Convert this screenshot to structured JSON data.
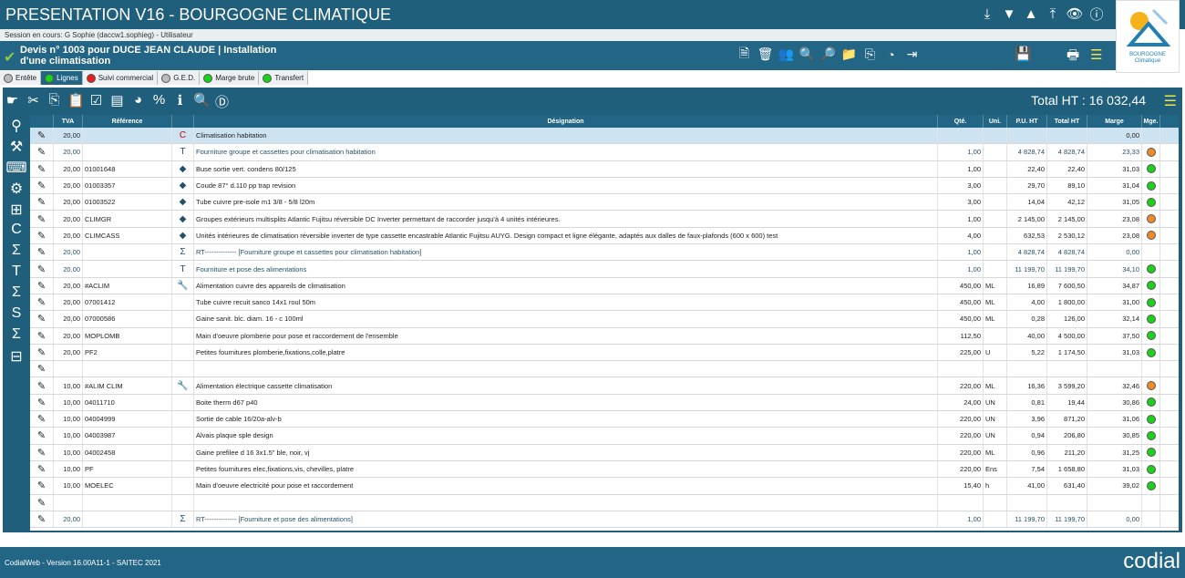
{
  "app": {
    "title": "PRESENTATION V16 - BOURGOGNE CLIMATIQUE",
    "logo_line1": "BOURGOGNE",
    "logo_line2": "Climatique"
  },
  "session": {
    "text": "Session en cours: G        Sophie (daccw1.sophieg) - Utilisateur"
  },
  "doc": {
    "title": "Devis n° 1003 pour DUCE JEAN CLAUDE | Installation d'une climatisation"
  },
  "tabs": [
    {
      "label": "Entête",
      "color": "grey"
    },
    {
      "label": "Lignes",
      "color": "green"
    },
    {
      "label": "Suivi commercial",
      "color": "red"
    },
    {
      "label": "G.E.D.",
      "color": "grey"
    },
    {
      "label": "Marge brute",
      "color": "green"
    },
    {
      "label": "Transfert",
      "color": "green"
    }
  ],
  "total": {
    "label": "Total HT : 16 032,44"
  },
  "columns": {
    "tva": "TVA",
    "ref": "Référence",
    "des": "Désignation",
    "qte": "Qté.",
    "uni": "Uni.",
    "pu": "P.U. HT",
    "tot": "Total HT",
    "mar": "Marge",
    "mge": "Mge."
  },
  "rows": [
    {
      "tva": "20,00",
      "ref": "",
      "ico": "C",
      "des": "Climatisation habitation",
      "qte": "",
      "uni": "",
      "pu": "",
      "tot": "",
      "mar": "0,00",
      "mge": ""
    },
    {
      "tva": "20,00",
      "ref": "",
      "ico": "T",
      "des": "Fourniture groupe et cassettes pour climatisation habitation",
      "qte": "1,00",
      "uni": "",
      "pu": "4 828,74",
      "tot": "4 828,74",
      "mar": "23,33",
      "mge": "orange"
    },
    {
      "tva": "20,00",
      "ref": "01001648",
      "ico": "box",
      "des": "Buse sortie vert. condens 80/125",
      "qte": "1,00",
      "uni": "",
      "pu": "22,40",
      "tot": "22,40",
      "mar": "31,03",
      "mge": "green"
    },
    {
      "tva": "20,00",
      "ref": "01003357",
      "ico": "box",
      "des": "Coude 87° d.110 pp trap revision",
      "qte": "3,00",
      "uni": "",
      "pu": "29,70",
      "tot": "89,10",
      "mar": "31,04",
      "mge": "green"
    },
    {
      "tva": "20,00",
      "ref": "01003522",
      "ico": "box",
      "des": "Tube cuivre pre-isole m1 3/8 - 5/8 l20m",
      "qte": "3,00",
      "uni": "",
      "pu": "14,04",
      "tot": "42,12",
      "mar": "31,05",
      "mge": "green"
    },
    {
      "tva": "20,00",
      "ref": "CLIMGR",
      "ico": "box",
      "des": "Groupes extérieurs multisplits Atlantic Fujitsu réversible DC Inverter permettant de raccorder jusqu'à 4 unités intérieures.",
      "qte": "1,00",
      "uni": "",
      "pu": "2 145,00",
      "tot": "2 145,00",
      "mar": "23,08",
      "mge": "orange"
    },
    {
      "tva": "20,00",
      "ref": "CLIMCASS",
      "ico": "box",
      "des": "Unités intérieures de climatisation réversible inverter de type cassette encastrable Atlantic Fujitsu AUYG. Design compact et ligne élégante, adaptés aux dalles de faux-plafonds (600 x 600) test",
      "qte": "4,00",
      "uni": "",
      "pu": "632,53",
      "tot": "2 530,12",
      "mar": "23,08",
      "mge": "orange"
    },
    {
      "tva": "20,00",
      "ref": "",
      "ico": "Σ",
      "des": "RT-------------- [Fourniture groupe et cassettes pour climatisation habitation]",
      "qte": "1,00",
      "uni": "",
      "pu": "4 828,74",
      "tot": "4 828,74",
      "mar": "0,00",
      "mge": ""
    },
    {
      "tva": "20,00",
      "ref": "",
      "ico": "T",
      "des": "Fourniture et pose des alimentations",
      "qte": "1,00",
      "uni": "",
      "pu": "11 199,70",
      "tot": "11 199,70",
      "mar": "34,10",
      "mge": "green"
    },
    {
      "tva": "20,00",
      "ref": "#ACLIM",
      "ico": "wrench",
      "des": "Alimentation cuivre des appareils de climatisation",
      "qte": "450,00",
      "uni": "ML",
      "pu": "16,89",
      "tot": "7 600,50",
      "mar": "34,87",
      "mge": "green"
    },
    {
      "tva": "20,00",
      "ref": "07001412",
      "ico": "",
      "des": "Tube cuivre recuit sanco 14x1 roul 50m",
      "qte": "450,00",
      "uni": "ML",
      "pu": "4,00",
      "tot": "1 800,00",
      "mar": "31,00",
      "mge": "green"
    },
    {
      "tva": "20,00",
      "ref": "07000586",
      "ico": "",
      "des": "Gaine sanit. blc. diam. 16 - c 100ml",
      "qte": "450,00",
      "uni": "ML",
      "pu": "0,28",
      "tot": "126,00",
      "mar": "32,14",
      "mge": "green"
    },
    {
      "tva": "20,00",
      "ref": "MOPLOMB",
      "ico": "",
      "des": "Main d'oeuvre plomberie pour pose et raccordement de l'ensemble",
      "qte": "112,50",
      "uni": "",
      "pu": "40,00",
      "tot": "4 500,00",
      "mar": "37,50",
      "mge": "green"
    },
    {
      "tva": "20,00",
      "ref": "PF2",
      "ico": "",
      "des": "Petites fournitures plomberie,fixations,colle,platre",
      "qte": "225,00",
      "uni": "U",
      "pu": "5,22",
      "tot": "1 174,50",
      "mar": "31,03",
      "mge": "green"
    },
    {
      "tva": "",
      "ref": "",
      "ico": "",
      "des": "",
      "qte": "",
      "uni": "",
      "pu": "",
      "tot": "",
      "mar": "",
      "mge": ""
    },
    {
      "tva": "10,00",
      "ref": "#ALIM CLIM",
      "ico": "wrench",
      "des": "Alimentation électrique cassette climatisation",
      "qte": "220,00",
      "uni": "ML",
      "pu": "16,36",
      "tot": "3 599,20",
      "mar": "32,46",
      "mge": "orange"
    },
    {
      "tva": "10,00",
      "ref": "04011710",
      "ico": "",
      "des": "Boite therm d67 p40",
      "qte": "24,00",
      "uni": "UN",
      "pu": "0,81",
      "tot": "19,44",
      "mar": "30,86",
      "mge": "green"
    },
    {
      "tva": "10,00",
      "ref": "04004999",
      "ico": "",
      "des": "Sortie de cable 16/20a-alv-b",
      "qte": "220,00",
      "uni": "UN",
      "pu": "3,96",
      "tot": "871,20",
      "mar": "31,06",
      "mge": "green"
    },
    {
      "tva": "10,00",
      "ref": "04003987",
      "ico": "",
      "des": "Alvais plaque sple design",
      "qte": "220,00",
      "uni": "UN",
      "pu": "0,94",
      "tot": "206,80",
      "mar": "30,85",
      "mge": "green"
    },
    {
      "tva": "10,00",
      "ref": "04002458",
      "ico": "",
      "des": "Gaine prefilee d 16 3x1.5\" ble, noir, vj",
      "qte": "220,00",
      "uni": "ML",
      "pu": "0,96",
      "tot": "211,20",
      "mar": "31,25",
      "mge": "green"
    },
    {
      "tva": "10,00",
      "ref": "PF",
      "ico": "",
      "des": "Petites fournitures elec,fixations,vis, chevilles, platre",
      "qte": "220,00",
      "uni": "Ens",
      "pu": "7,54",
      "tot": "1 658,80",
      "mar": "31,03",
      "mge": "green"
    },
    {
      "tva": "10,00",
      "ref": "MOELEC",
      "ico": "",
      "des": "Main d'oeuvre electricité pour pose et raccordement",
      "qte": "15,40",
      "uni": "h",
      "pu": "41,00",
      "tot": "631,40",
      "mar": "39,02",
      "mge": "green"
    },
    {
      "tva": "",
      "ref": "",
      "ico": "",
      "des": "",
      "qte": "",
      "uni": "",
      "pu": "",
      "tot": "",
      "mar": "",
      "mge": ""
    },
    {
      "tva": "20,00",
      "ref": "",
      "ico": "Σ",
      "des": "RT-------------- [Fourniture et pose des alimentations]",
      "qte": "1,00",
      "uni": "",
      "pu": "11 199,70",
      "tot": "11 199,70",
      "mar": "0,00",
      "mge": ""
    }
  ],
  "footer": {
    "version": "CodialWeb - Version 16.00A11-1 - SAITEC 2021",
    "brand": "codial"
  }
}
